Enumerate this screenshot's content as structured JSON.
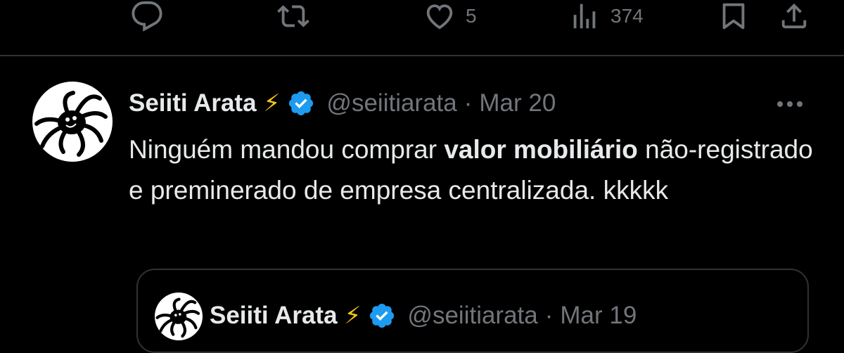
{
  "action_bar": {
    "reply_icon": "reply-icon",
    "retweet_icon": "retweet-icon",
    "like_icon": "heart-icon",
    "like_count": "5",
    "views_icon": "views-icon",
    "views_count": "374",
    "bookmark_icon": "bookmark-icon",
    "share_icon": "share-icon"
  },
  "tweet": {
    "author_name": "Seiiti Arata",
    "emoji": "⚡",
    "handle": "@seiitiarata",
    "separator": "·",
    "date": "Mar 20",
    "more_icon": "more-icon",
    "text_part1": "Ninguém mandou comprar ",
    "text_bold": "valor mobiliário",
    "text_part2": " não-registrado e preminerado de empresa centralizada. kkkkk"
  },
  "quoted_tweet": {
    "author_name": "Seiiti Arata",
    "emoji": "⚡",
    "handle": "@seiitiarata",
    "separator": "·",
    "date": "Mar 19"
  },
  "colors": {
    "background": "#000000",
    "text": "#e7e9ea",
    "muted": "#71767b",
    "border": "#2f3336",
    "verified": "#1d9bf0",
    "bolt": "#f5c518"
  }
}
